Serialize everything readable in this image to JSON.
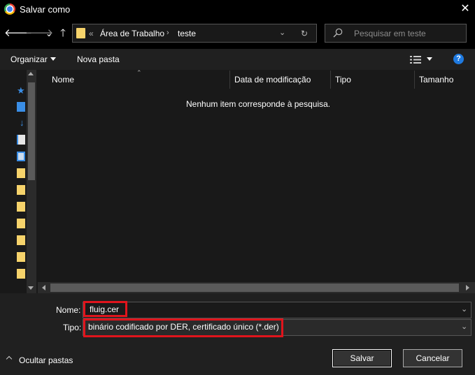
{
  "window": {
    "title": "Salvar como",
    "close_glyph": "✕",
    "icon": "chrome-icon"
  },
  "nav": {
    "back": "🡐",
    "forward": "🡒",
    "recent": "⌄",
    "up": "🡑"
  },
  "address": {
    "overflow": "«",
    "segments": [
      "Área de Trabalho",
      "teste"
    ],
    "separator": "›",
    "refresh": "↻",
    "dropdown": "⌄"
  },
  "search": {
    "placeholder": "Pesquisar em teste",
    "icon": "search-icon"
  },
  "toolbar": {
    "organize": "Organizar",
    "new_folder": "Nova pasta",
    "help": "?"
  },
  "columns": [
    "Nome",
    "Data de modificação",
    "Tipo",
    "Tamanho"
  ],
  "empty_message": "Nenhum item corresponde à pesquisa.",
  "form": {
    "name_label": "Nome:",
    "name_value": "fluig.cer",
    "type_label": "Tipo:",
    "type_value": "binário codificado por DER, certificado único (*.der)"
  },
  "footer": {
    "hide_folders": "Ocultar pastas",
    "save": "Salvar",
    "cancel": "Cancelar"
  },
  "colors": {
    "highlight": "#e0141c",
    "folder": "#f6d36b",
    "accent": "#1f7ae0"
  }
}
